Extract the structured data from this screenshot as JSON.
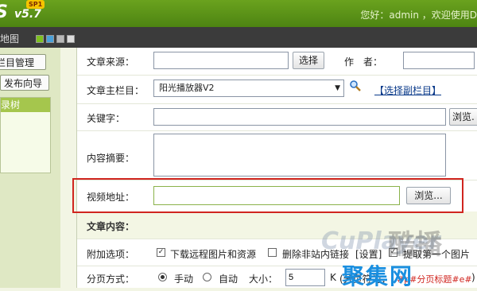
{
  "header": {
    "logo_letter": "S",
    "version": "v5.7",
    "sp_badge": "SP1",
    "welcome": "您好：admin ，欢迎使用D"
  },
  "subbar": {
    "map_label": "地图",
    "swatches": [
      "#7ec11f",
      "#4aa0d8",
      "#b8b8b8",
      "#dcdcdc"
    ]
  },
  "left_panel": {
    "manage_button": "栏目管理",
    "publish_button": "发布向导",
    "tree_title": "录树"
  },
  "form": {
    "source_label": "文章来源：",
    "source_value": "",
    "select_button": "选择",
    "author_label": "作　者：",
    "author_value": "",
    "main_column_label": "文章主栏目：",
    "main_column_value": "阳光播放器V2",
    "sub_column_link": "【选择副栏目】",
    "keyword_label": "关键字：",
    "keyword_value": "",
    "browse_label_1": "浏览.",
    "summary_label": "内容摘要：",
    "summary_value": "",
    "video_label": "视频地址：",
    "video_value": "",
    "browse_label_2": "浏览...",
    "content_section": "文章内容：",
    "options_label": "附加选项：",
    "option_download": "下载远程图片和资源",
    "option_delete_links": "删除非站内链接",
    "option_settings": "[设置]",
    "option_extract": "提取第一个图片",
    "paging_label": "分页方式：",
    "paging_manual": "手动",
    "paging_auto": "自动",
    "size_label": "大小：",
    "size_value": "5",
    "size_unit": "K",
    "paging_note": "(分页符为：",
    "paging_code": "#p#分页标题#e#",
    "paging_close": ")"
  },
  "watermark": {
    "brand_en": "CuPlayer",
    "brand_cn": "酷播",
    "blue_text": "聚集网"
  },
  "colors": {
    "topbar": "#5a9418",
    "highlight_border": "#d0251f",
    "video_input_border": "#8ab24a",
    "section_bg": "#f3f6e4",
    "paging_code": "#d0251f"
  }
}
